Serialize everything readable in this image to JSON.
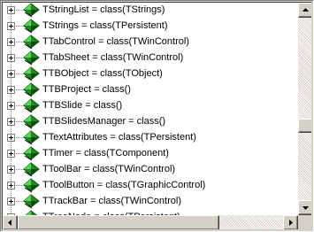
{
  "tree": {
    "items": [
      {
        "label": "TStringList = class(TStrings)"
      },
      {
        "label": "TStrings = class(TPersistent)"
      },
      {
        "label": "TTabControl = class(TWinControl)"
      },
      {
        "label": "TTabSheet = class(TWinControl)"
      },
      {
        "label": "TTBObject = class(TObject)"
      },
      {
        "label": "TTBProject = class()"
      },
      {
        "label": "TTBSlide = class()"
      },
      {
        "label": "TTBSlidesManager = class()"
      },
      {
        "label": "TTextAttributes = class(TPersistent)"
      },
      {
        "label": "TTimer = class(TComponent)"
      },
      {
        "label": "TToolBar = class(TWinControl)"
      },
      {
        "label": "TToolButton = class(TGraphicControl)"
      },
      {
        "label": "TTrackBar = class(TWinControl)"
      },
      {
        "label": "TTreeNode = class(TPersistent)"
      }
    ]
  },
  "icons": {
    "node": "green-diamond-class-icon",
    "expander": "plus-expander-icon"
  },
  "colors": {
    "node_green": "#1e8c1e",
    "node_dark": "#0b4f0b",
    "background": "#ffffff",
    "chrome": "#d4d0c8"
  }
}
